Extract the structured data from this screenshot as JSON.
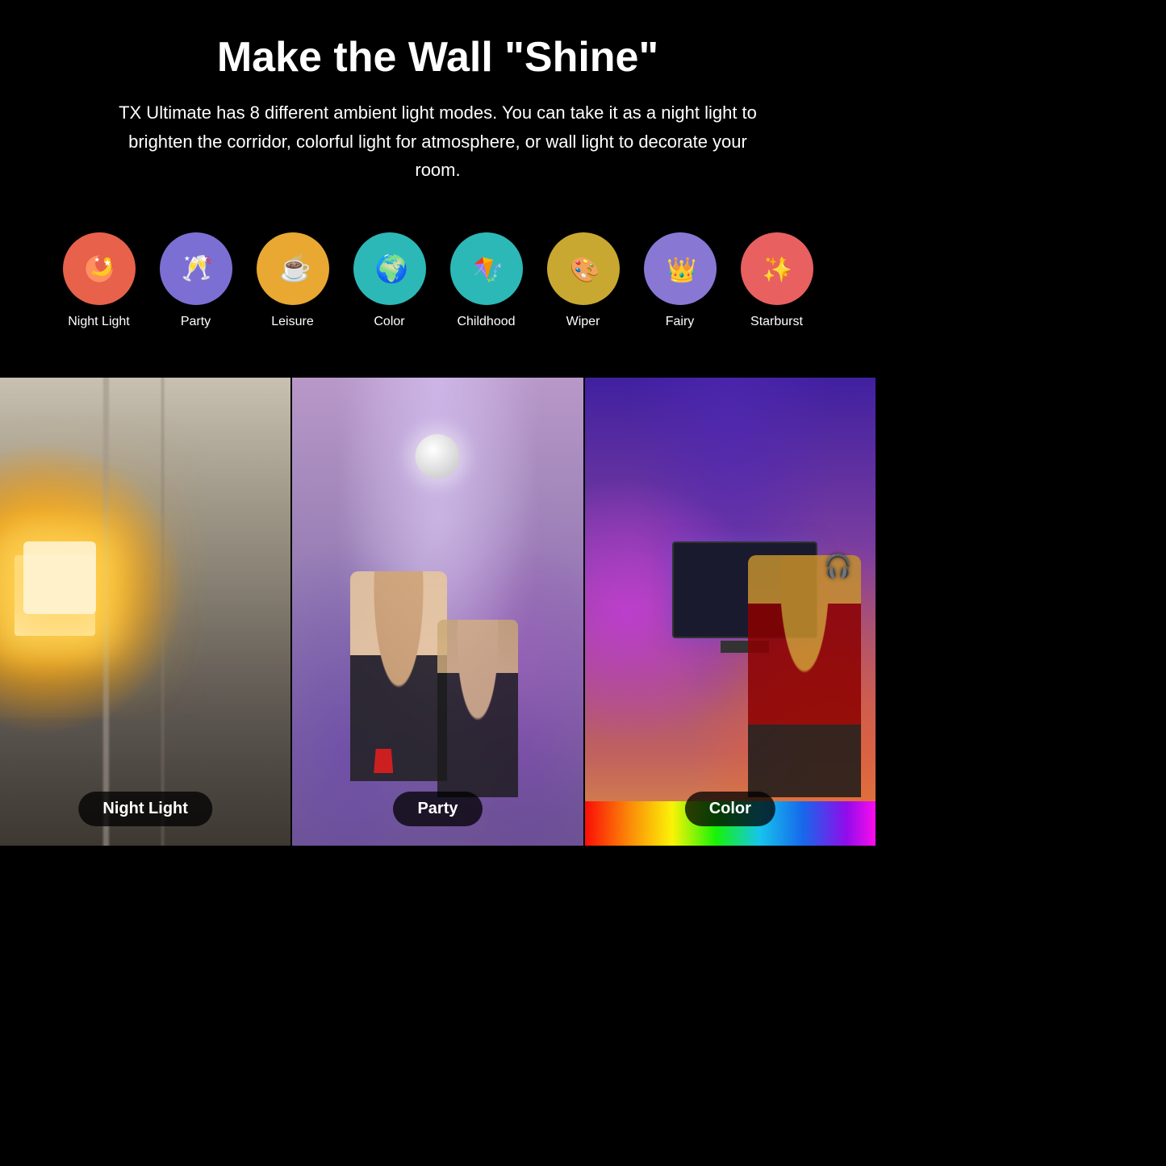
{
  "header": {
    "title": "Make the Wall \"Shine\"",
    "subtitle": "TX Ultimate has 8 different ambient light modes. You can take it as a night light to brighten the corridor, colorful light for atmosphere, or wall light to decorate your room."
  },
  "modes": [
    {
      "id": "night-light",
      "label": "Night Light",
      "emoji": "🌙",
      "bgClass": "icon-night-light",
      "svgType": "moon"
    },
    {
      "id": "party",
      "label": "Party",
      "emoji": "🥂",
      "bgClass": "icon-party",
      "svgType": "party"
    },
    {
      "id": "leisure",
      "label": "Leisure",
      "emoji": "☕",
      "bgClass": "icon-leisure",
      "svgType": "leisure"
    },
    {
      "id": "color",
      "label": "Color",
      "emoji": "🌍",
      "bgClass": "icon-color",
      "svgType": "color"
    },
    {
      "id": "childhood",
      "label": "Childhood",
      "emoji": "🪁",
      "bgClass": "icon-childhood",
      "svgType": "childhood"
    },
    {
      "id": "wiper",
      "label": "Wiper",
      "emoji": "🎨",
      "bgClass": "icon-wiper",
      "svgType": "wiper"
    },
    {
      "id": "fairy",
      "label": "Fairy",
      "emoji": "👑",
      "bgClass": "icon-fairy",
      "svgType": "fairy"
    },
    {
      "id": "starburst",
      "label": "Starburst",
      "emoji": "✨",
      "bgClass": "icon-starburst",
      "svgType": "starburst"
    }
  ],
  "photos": [
    {
      "id": "night-light-photo",
      "label": "Night Light",
      "panelClass": "panel-night"
    },
    {
      "id": "party-photo",
      "label": "Party",
      "panelClass": "panel-party"
    },
    {
      "id": "color-photo",
      "label": "Color",
      "panelClass": "panel-color"
    }
  ]
}
